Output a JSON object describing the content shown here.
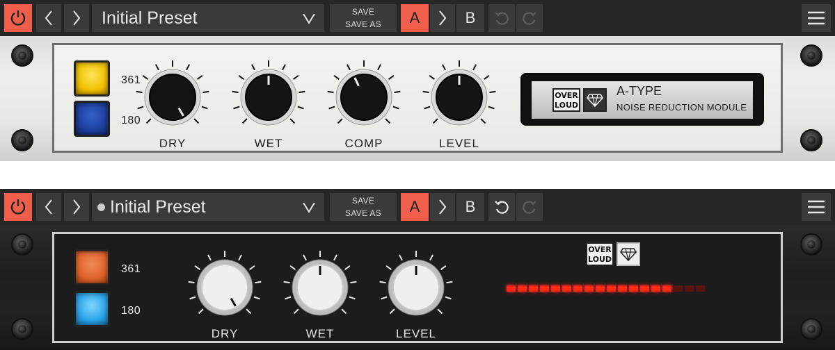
{
  "toolbar": {
    "preset_name": "Initial Preset",
    "save_label": "SAVE",
    "save_as_label": "SAVE AS",
    "a_label": "A",
    "b_label": "B",
    "icons": [
      "power-icon",
      "chevron-left-icon",
      "chevron-right-icon",
      "chevron-down-icon",
      "copy-arrow-icon",
      "undo-icon",
      "redo-icon",
      "hamburger-menu-icon"
    ]
  },
  "top_unit": {
    "button_labels": [
      "361",
      "180"
    ],
    "button_colors": [
      "#f2c200",
      "#1d3f9f"
    ],
    "knobs": [
      "DRY",
      "WET",
      "COMP",
      "LEVEL"
    ],
    "logo_text": [
      "OVER",
      "LOUD"
    ],
    "display_title": "A-TYPE",
    "display_subtitle": "NOISE REDUCTION MODULE"
  },
  "bottom_unit": {
    "button_labels": [
      "361",
      "180"
    ],
    "button_colors": [
      "#e0632a",
      "#2ba4e8"
    ],
    "knobs": [
      "DRY",
      "WET",
      "LEVEL"
    ],
    "logo_text": [
      "OVER",
      "LOUD"
    ],
    "meter_lit_fraction": 0.83
  },
  "colors": {
    "accent": "#ef5f4b",
    "toolbar_bg": "#262626",
    "meter_on": "#ff2a1a",
    "meter_off": "#5a1410"
  }
}
